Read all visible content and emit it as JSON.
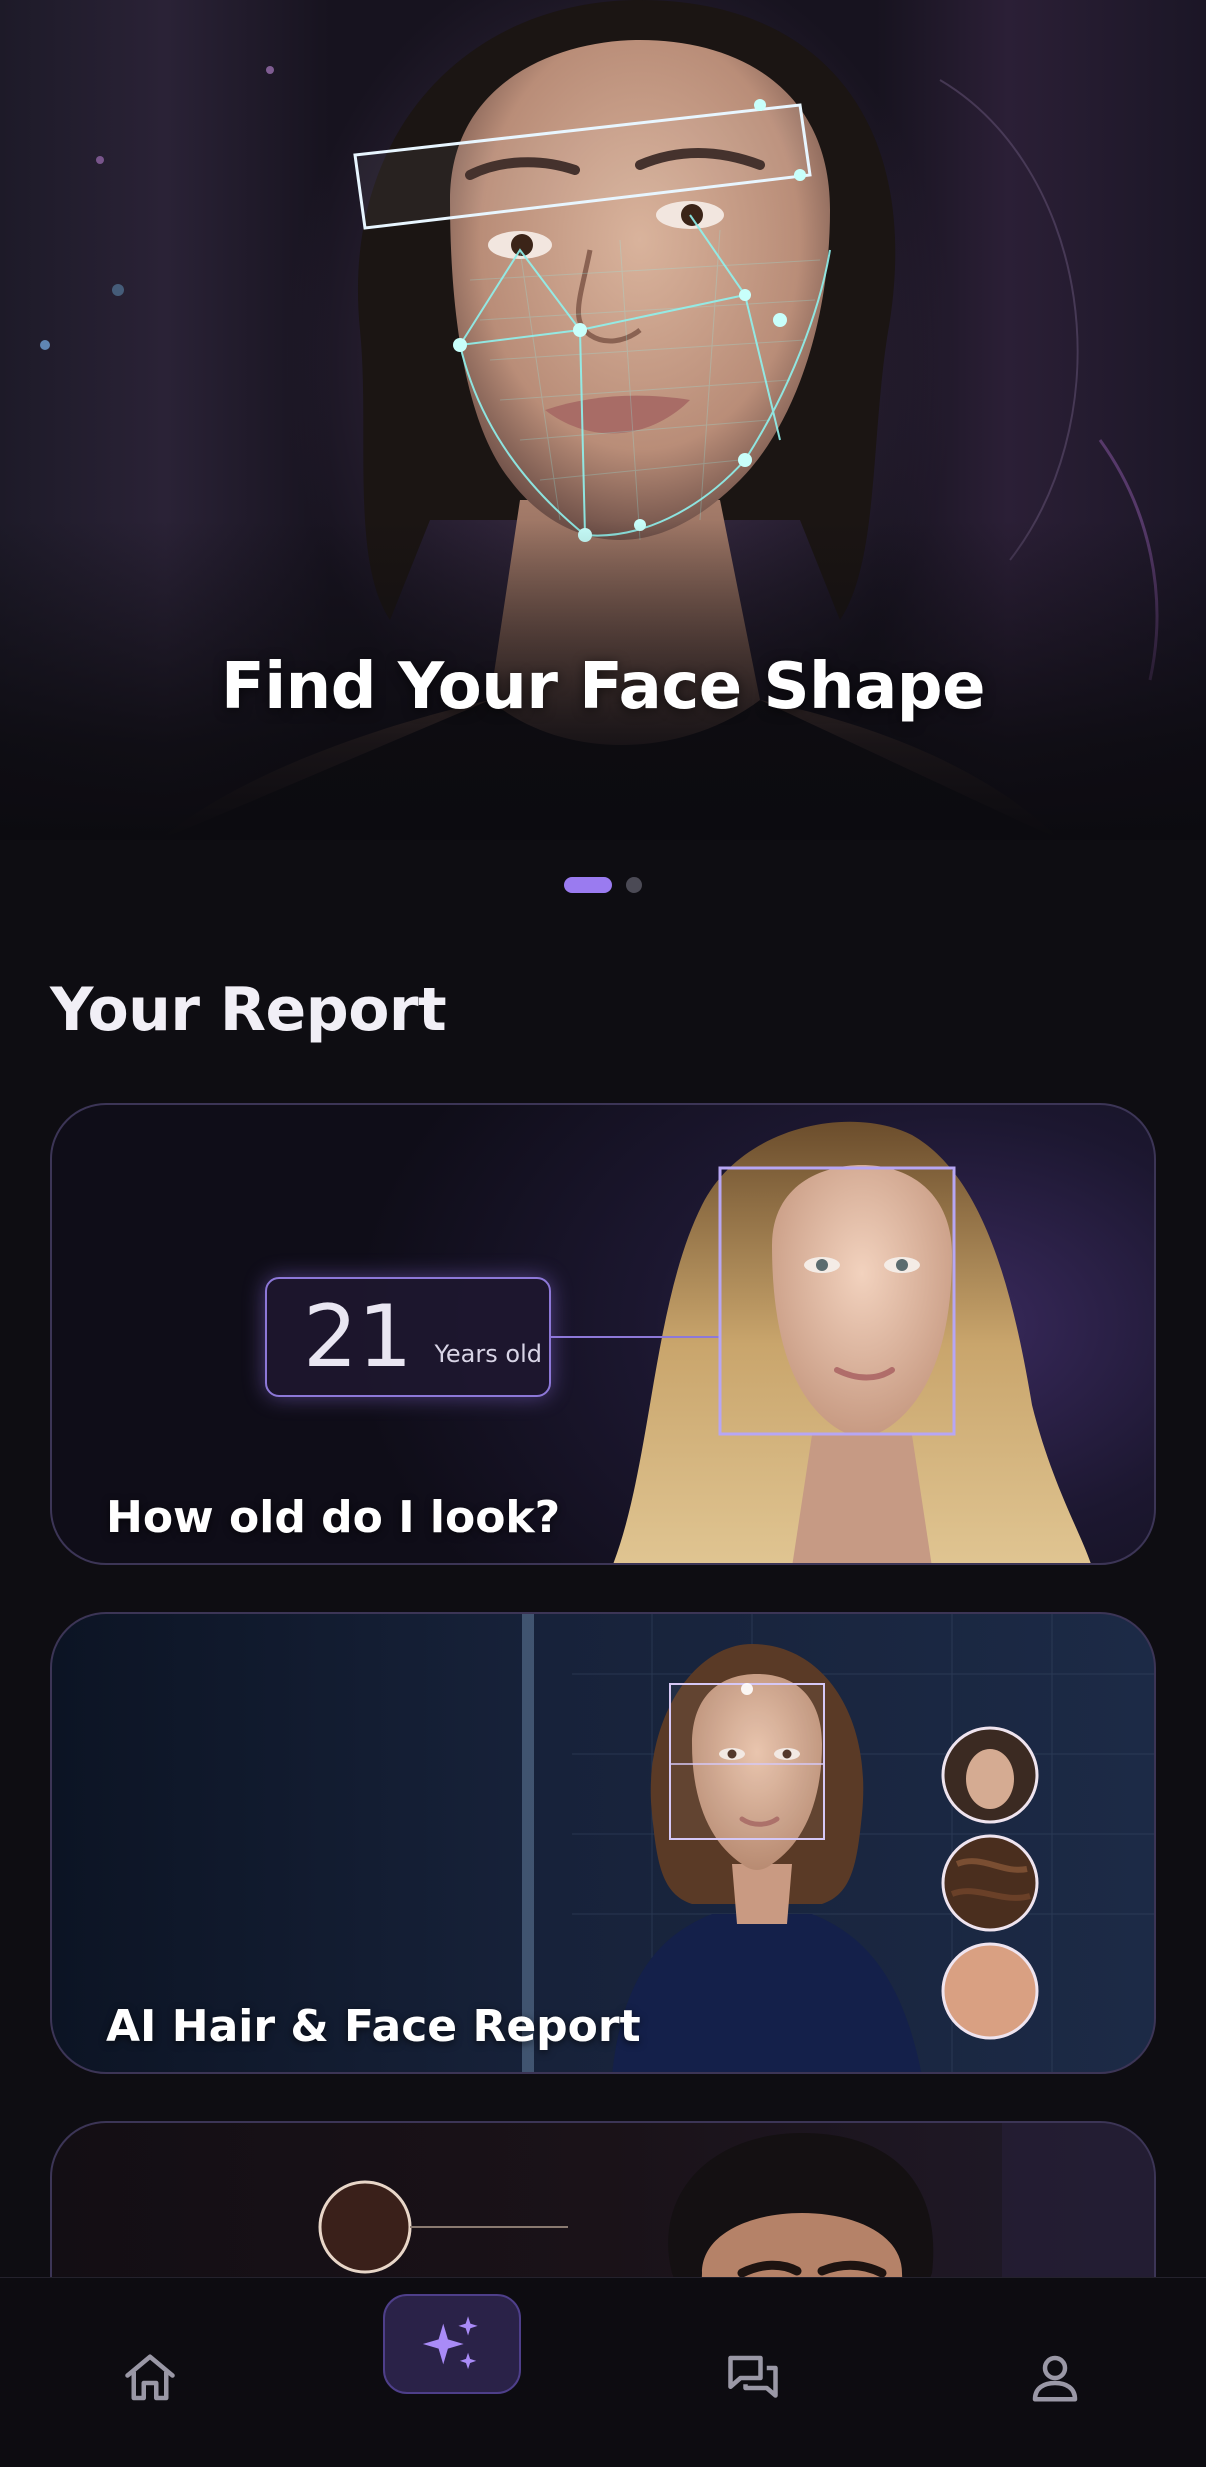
{
  "hero": {
    "title": "Find Your Face Shape",
    "slides_total": 2,
    "active_slide": 1
  },
  "report": {
    "section_title": "Your Report",
    "cards": [
      {
        "title": "How old do I look?",
        "age_value": "21",
        "age_unit": "Years old"
      },
      {
        "title": "AI Hair & Face Report"
      },
      {
        "title": ""
      }
    ]
  },
  "nav": {
    "items": [
      {
        "icon": "home-icon",
        "active": false
      },
      {
        "icon": "sparkles-icon",
        "active": true
      },
      {
        "icon": "chat-icon",
        "active": false
      },
      {
        "icon": "profile-icon",
        "active": false
      }
    ]
  },
  "colors": {
    "accent": "#9a7bf0",
    "background": "#0e0d12",
    "scan_lines": "#8ff2ee"
  }
}
